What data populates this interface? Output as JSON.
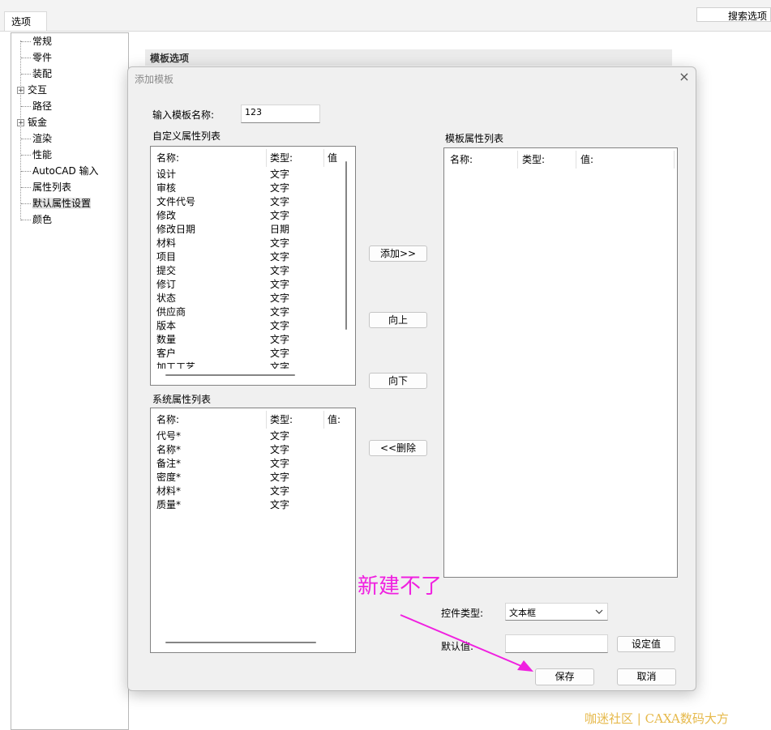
{
  "window": {
    "tab_label": "选项",
    "search_button": "搜索选项"
  },
  "tree": {
    "items": [
      {
        "label": "常规",
        "expandable": false
      },
      {
        "label": "零件",
        "expandable": false
      },
      {
        "label": "装配",
        "expandable": false
      },
      {
        "label": "交互",
        "expandable": true
      },
      {
        "label": "路径",
        "expandable": false
      },
      {
        "label": "钣金",
        "expandable": true
      },
      {
        "label": "渲染",
        "expandable": false
      },
      {
        "label": "性能",
        "expandable": false
      },
      {
        "label": "AutoCAD 输入",
        "expandable": false
      },
      {
        "label": "属性列表",
        "expandable": false
      },
      {
        "label": "默认属性设置",
        "expandable": false,
        "selected": true
      },
      {
        "label": "颜色",
        "expandable": false
      }
    ]
  },
  "section_header": "模板选项",
  "dialog": {
    "title": "添加模板",
    "close_icon": "×",
    "template_name_label": "输入模板名称:",
    "template_name_value": "123",
    "custom_list": {
      "title": "自定义属性列表",
      "headers": [
        "名称:",
        "类型:",
        "值"
      ],
      "rows": [
        [
          "设计",
          "文字"
        ],
        [
          "审核",
          "文字"
        ],
        [
          "文件代号",
          "文字"
        ],
        [
          "修改",
          "文字"
        ],
        [
          "修改日期",
          "日期"
        ],
        [
          "材料",
          "文字"
        ],
        [
          "项目",
          "文字"
        ],
        [
          "提交",
          "文字"
        ],
        [
          "修订",
          "文字"
        ],
        [
          "状态",
          "文字"
        ],
        [
          "供应商",
          "文字"
        ],
        [
          "版本",
          "文字"
        ],
        [
          "数量",
          "文字"
        ],
        [
          "客户",
          "文字"
        ],
        [
          "加工工艺",
          "文字"
        ]
      ]
    },
    "system_list": {
      "title": "系统属性列表",
      "headers": [
        "名称:",
        "类型:",
        "值:"
      ],
      "rows": [
        [
          "代号*",
          "文字"
        ],
        [
          "名称*",
          "文字"
        ],
        [
          "备注*",
          "文字"
        ],
        [
          "密度*",
          "文字"
        ],
        [
          "材料*",
          "文字"
        ],
        [
          "质量*",
          "文字"
        ]
      ]
    },
    "template_list": {
      "title": "模板属性列表",
      "headers": [
        "名称:",
        "类型:",
        "值:"
      ]
    },
    "buttons": {
      "add": "添加>>",
      "up": "向上",
      "down": "向下",
      "delete": "<<删除",
      "set_value": "设定值",
      "save": "保存",
      "cancel": "取消"
    },
    "control_type_label": "控件类型:",
    "control_type_value": "文本框",
    "default_value_label": "默认值:",
    "default_value": ""
  },
  "annotation": "新建不了",
  "watermark": "咖迷社区 | CAXA数码大方",
  "colors": {
    "annotation": "#f020e0",
    "watermark": "#e6b94b"
  }
}
